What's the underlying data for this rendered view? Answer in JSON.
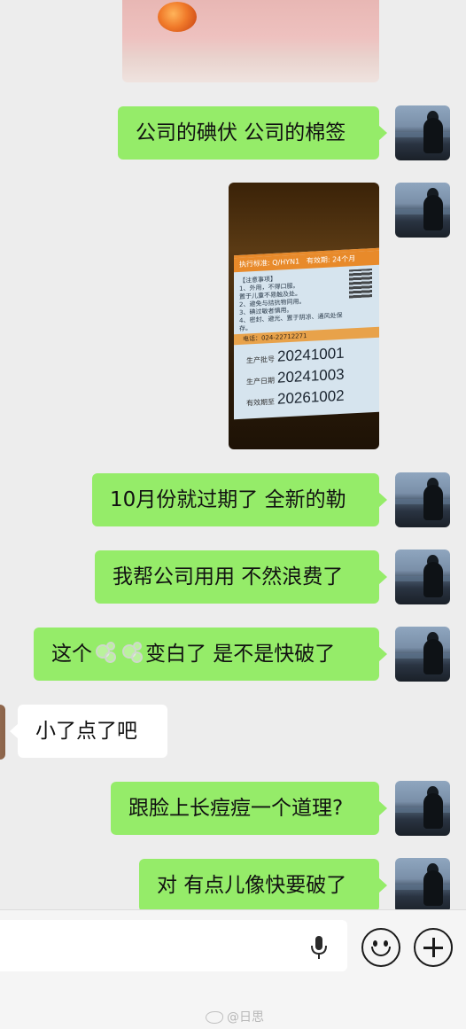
{
  "messages": [
    {
      "text": "公司的碘伏 公司的棉签"
    },
    {
      "text": "10月份就过期了 全新的勒"
    },
    {
      "text": "我帮公司用用 不然浪费了"
    },
    {
      "text_before": "这个",
      "text_after": "变白了 是不是快破了"
    },
    {
      "text": "小了点了吧"
    },
    {
      "text": "跟脸上长痘痘一个道理?"
    },
    {
      "text": "对 有点儿像快要破了"
    }
  ],
  "bottle_label": {
    "standard": "执行标准: Q/HYN1",
    "validity": "有效期: 24个月",
    "notes_title": "【注意事项】",
    "notes": [
      "1、外用，不得口服。",
      "置于儿童不易触及处。",
      "2、避免与拮抗物同用。",
      "3、碘过敏者慎用。",
      "4、密封、避光、置于阴凉、通风处保存。"
    ],
    "phone": "电话：024-22712271",
    "batch_label": "生产批号",
    "batch": "20241001",
    "date_label": "生产日期",
    "date": "20241003",
    "expiry_label": "有效期至",
    "expiry": "20261002"
  },
  "watermark": "@日思"
}
